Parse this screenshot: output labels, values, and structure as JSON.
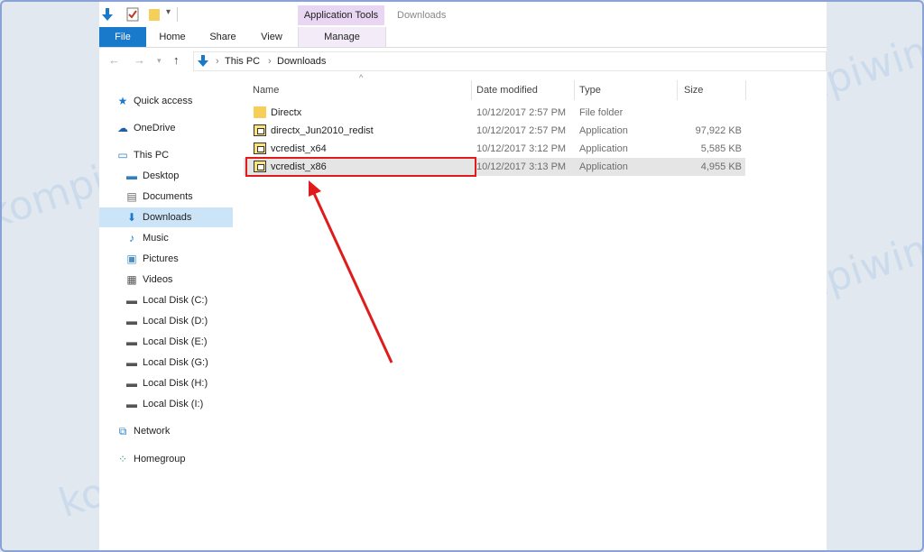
{
  "titlebar": {
    "context_tab": "Application Tools",
    "window_title": "Downloads"
  },
  "ribbon": {
    "tabs": [
      {
        "label": "File"
      },
      {
        "label": "Home"
      },
      {
        "label": "Share"
      },
      {
        "label": "View"
      },
      {
        "label": "Manage"
      }
    ]
  },
  "address": {
    "crumbs": [
      "This PC",
      "Downloads"
    ]
  },
  "navpane": {
    "items": [
      {
        "label": "Quick access",
        "icon": "star-icon"
      },
      {
        "label": "OneDrive",
        "icon": "cloud-icon"
      },
      {
        "label": "This PC",
        "icon": "computer-icon"
      },
      {
        "label": "Desktop",
        "icon": "desktop-icon"
      },
      {
        "label": "Documents",
        "icon": "document-icon"
      },
      {
        "label": "Downloads",
        "icon": "download-icon"
      },
      {
        "label": "Music",
        "icon": "music-icon"
      },
      {
        "label": "Pictures",
        "icon": "picture-icon"
      },
      {
        "label": "Videos",
        "icon": "video-icon"
      },
      {
        "label": "Local Disk (C:)",
        "icon": "disk-icon"
      },
      {
        "label": "Local Disk (D:)",
        "icon": "disk-icon"
      },
      {
        "label": "Local Disk (E:)",
        "icon": "disk-icon"
      },
      {
        "label": "Local Disk (G:)",
        "icon": "disk-icon"
      },
      {
        "label": "Local Disk (H:)",
        "icon": "disk-icon"
      },
      {
        "label": "Local Disk (I:)",
        "icon": "disk-icon"
      },
      {
        "label": "Network",
        "icon": "network-icon"
      },
      {
        "label": "Homegroup",
        "icon": "homegroup-icon"
      }
    ]
  },
  "filelist": {
    "columns": [
      "Name",
      "Date modified",
      "Type",
      "Size"
    ],
    "rows": [
      {
        "name": "Directx",
        "date": "10/12/2017 2:57 PM",
        "type": "File folder",
        "size": ""
      },
      {
        "name": "directx_Jun2010_redist",
        "date": "10/12/2017 2:57 PM",
        "type": "Application",
        "size": "97,922 KB"
      },
      {
        "name": "vcredist_x64",
        "date": "10/12/2017 3:12 PM",
        "type": "Application",
        "size": "5,585 KB"
      },
      {
        "name": "vcredist_x86",
        "date": "10/12/2017 3:13 PM",
        "type": "Application",
        "size": "4,955 KB"
      }
    ]
  },
  "watermark": "kompiwin",
  "colors": {
    "accent": "#1979ca",
    "highlight": "#e01b1b",
    "selection": "#cce4f7"
  }
}
